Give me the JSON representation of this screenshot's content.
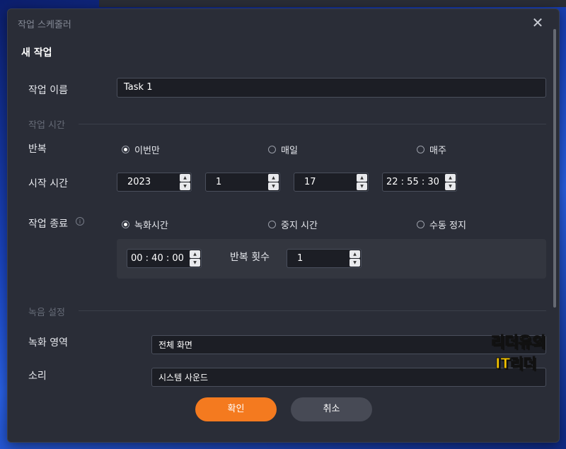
{
  "dialog": {
    "title": "작업 스케줄러",
    "heading": "새 작업"
  },
  "task_name": {
    "label": "작업 이름",
    "value": "Task 1"
  },
  "schedule_section": "작업 시간",
  "repeat": {
    "label": "반복",
    "options": [
      {
        "label": "이번만",
        "selected": true
      },
      {
        "label": "매일",
        "selected": false
      },
      {
        "label": "매주",
        "selected": false
      }
    ]
  },
  "start_time": {
    "label": "시작 시간",
    "year": "2023",
    "month": "1",
    "day": "17",
    "time": "22 : 55 : 30"
  },
  "end_task": {
    "label": "작업 종료",
    "options": [
      {
        "label": "녹화시간",
        "selected": true
      },
      {
        "label": "중지 시간",
        "selected": false
      },
      {
        "label": "수동 정지",
        "selected": false
      }
    ],
    "duration": "00 : 40 : 00",
    "repeat_count_label": "반복 횟수",
    "repeat_count": "1"
  },
  "recording_section": "녹음 설정",
  "record_area": {
    "label": "녹화 영역",
    "value": "전체 화면"
  },
  "sound": {
    "label": "소리",
    "value": "시스템 사운드"
  },
  "buttons": {
    "ok": "확인",
    "cancel": "취소"
  },
  "watermark": {
    "line1": "리더유의",
    "line2": "IT리더"
  },
  "icons": {
    "close": "close-icon",
    "info": "info-icon"
  },
  "colors": {
    "accent": "#f47a1f",
    "dialog_bg": "#2a2d37"
  }
}
